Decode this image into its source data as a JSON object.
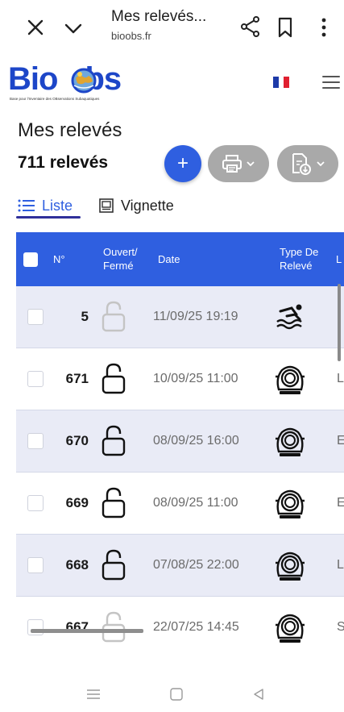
{
  "browser": {
    "title": "Mes relevés...",
    "url": "bioobs.fr"
  },
  "site": {
    "logo_text": "BioObs",
    "logo_tagline": "Base pour l'Inventaire des OBservations Subaquatiques",
    "language": "FR",
    "colors": {
      "primary": "#2f5fe0",
      "logo": "#1d46c8",
      "row_alt": "#e9ebf6"
    }
  },
  "page": {
    "title": "Mes relevés",
    "count": "711 relevés",
    "add_label": "+"
  },
  "tabs": [
    {
      "label": "Liste",
      "icon": "list-icon",
      "active": true
    },
    {
      "label": "Vignette",
      "icon": "grid-icon",
      "active": false
    }
  ],
  "table": {
    "columns": {
      "num": "N°",
      "open_closed_line1": "Ouvert/",
      "open_closed_line2": "Fermé",
      "date": "Date",
      "type_line1": "Type De",
      "type_line2": "Relevé",
      "location": "L"
    },
    "rows": [
      {
        "num": "5",
        "lock": "unlocked-grey",
        "date": "11/09/25 19:19",
        "type": "swimmer-icon",
        "loc": ""
      },
      {
        "num": "671",
        "lock": "unlocked",
        "date": "10/09/25 11:00",
        "type": "diving-helmet-icon",
        "loc": "La"
      },
      {
        "num": "670",
        "lock": "unlocked",
        "date": "08/09/25 16:00",
        "type": "diving-helmet-icon",
        "loc": "El"
      },
      {
        "num": "669",
        "lock": "unlocked",
        "date": "08/09/25 11:00",
        "type": "diving-helmet-icon",
        "loc": "El"
      },
      {
        "num": "668",
        "lock": "unlocked",
        "date": "07/08/25 22:00",
        "type": "diving-helmet-icon",
        "loc": "La"
      },
      {
        "num": "667",
        "lock": "unlocked-grey",
        "date": "22/07/25 14:45",
        "type": "diving-helmet-icon",
        "loc": "St"
      }
    ]
  }
}
